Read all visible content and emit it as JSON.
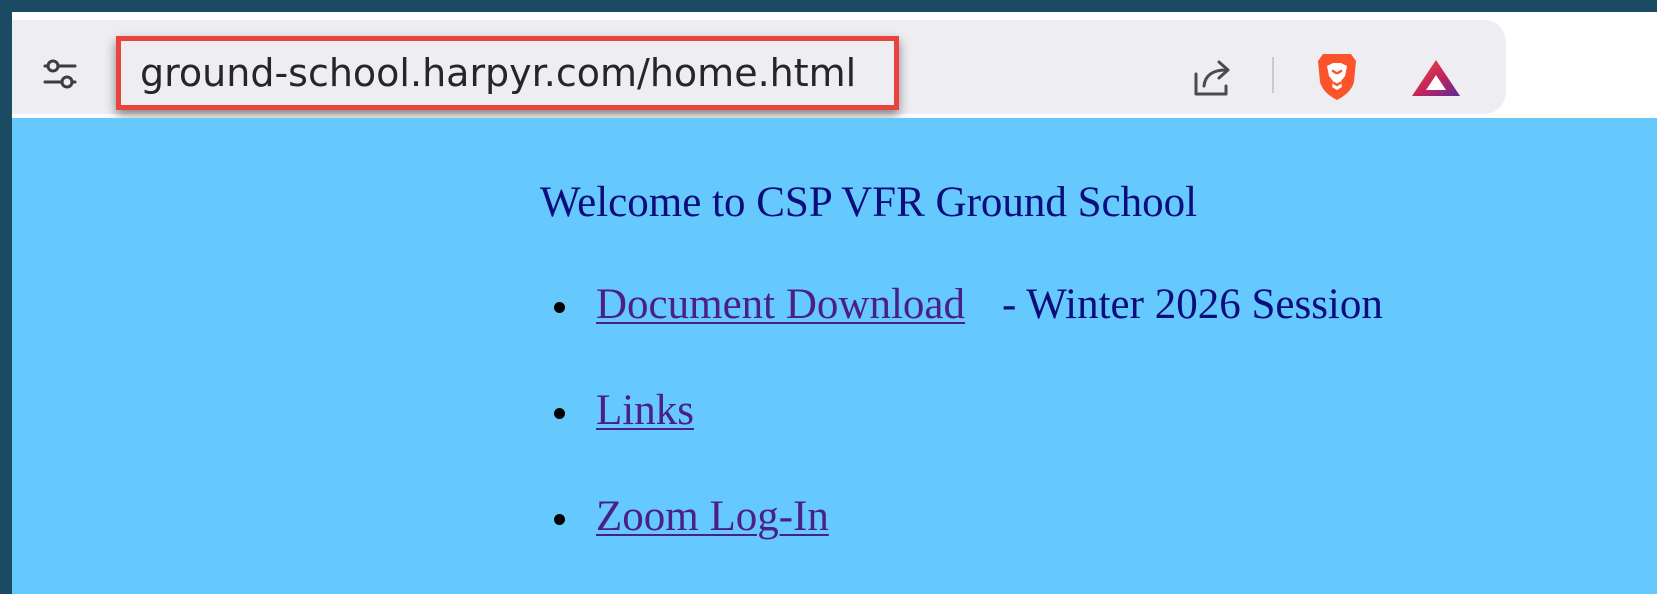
{
  "toolbar": {
    "url": "ground-school.harpyr.com/home.html",
    "icons": {
      "site_settings": "tune-icon",
      "share": "share-icon",
      "shields": "brave-lion-icon",
      "rewards": "rewards-triangle-icon"
    }
  },
  "page": {
    "title": "Welcome to CSP VFR Ground School",
    "links": [
      {
        "label": "Document Download",
        "suffix": " - Winter 2026 Session"
      },
      {
        "label": "Links",
        "suffix": ""
      },
      {
        "label": "Zoom Log-In",
        "suffix": ""
      }
    ]
  },
  "colors": {
    "outer_border": "#1b4b63",
    "page_background": "#66c9fe",
    "text": "#0c0c7a",
    "link": "#4b1e8a",
    "highlight_box": "#e8433c",
    "omnibox": "#eeeef2"
  }
}
